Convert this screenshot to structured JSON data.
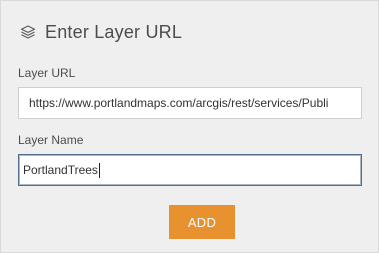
{
  "panel": {
    "title": "Enter Layer URL",
    "icon": "layers-icon"
  },
  "layer_url": {
    "label": "Layer URL",
    "value": "https://www.portlandmaps.com/arcgis/rest/services/Publi"
  },
  "layer_name": {
    "label": "Layer Name",
    "value": "PortlandTrees"
  },
  "actions": {
    "add_label": "ADD"
  },
  "colors": {
    "accent": "#e8922f",
    "focus_border": "#566f8f",
    "panel_bg": "#efefef"
  }
}
